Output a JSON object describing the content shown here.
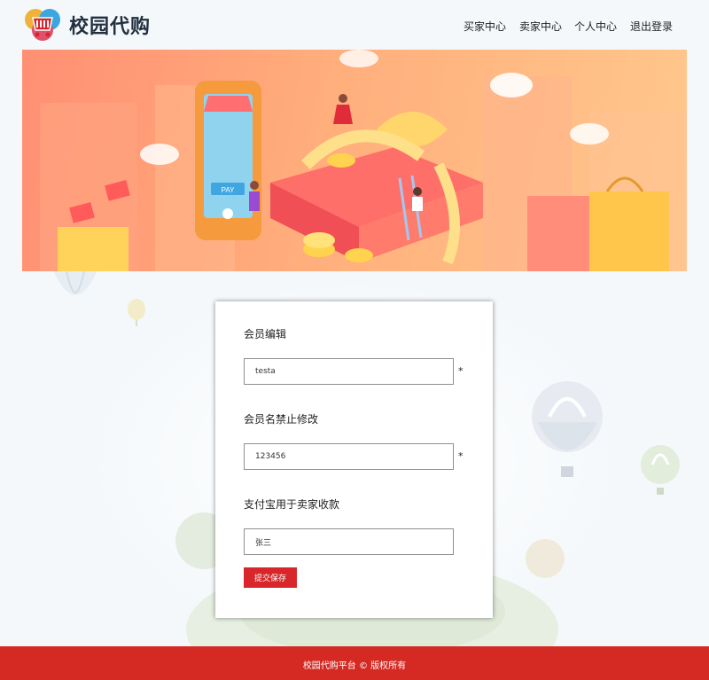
{
  "header": {
    "brand": "校园代购",
    "nav": [
      {
        "label": "买家中心"
      },
      {
        "label": "卖家中心"
      },
      {
        "label": "个人中心"
      },
      {
        "label": "退出登录"
      }
    ]
  },
  "banner": {
    "phone_badge": "PAY"
  },
  "form": {
    "title": "会员编辑",
    "username": {
      "value": "testa",
      "required_mark": "*"
    },
    "label_password": "会员名禁止修改",
    "password": {
      "value": "123456",
      "required_mark": "*"
    },
    "label_alipay": "支付宝用于卖家收款",
    "alipay": {
      "value": "张三"
    },
    "submit_label": "提交保存"
  },
  "footer": {
    "text": "校园代购平台 © 版权所有"
  },
  "colors": {
    "accent": "#d52a24",
    "banner_start": "#ff8f73",
    "banner_end": "#ffc88c"
  }
}
